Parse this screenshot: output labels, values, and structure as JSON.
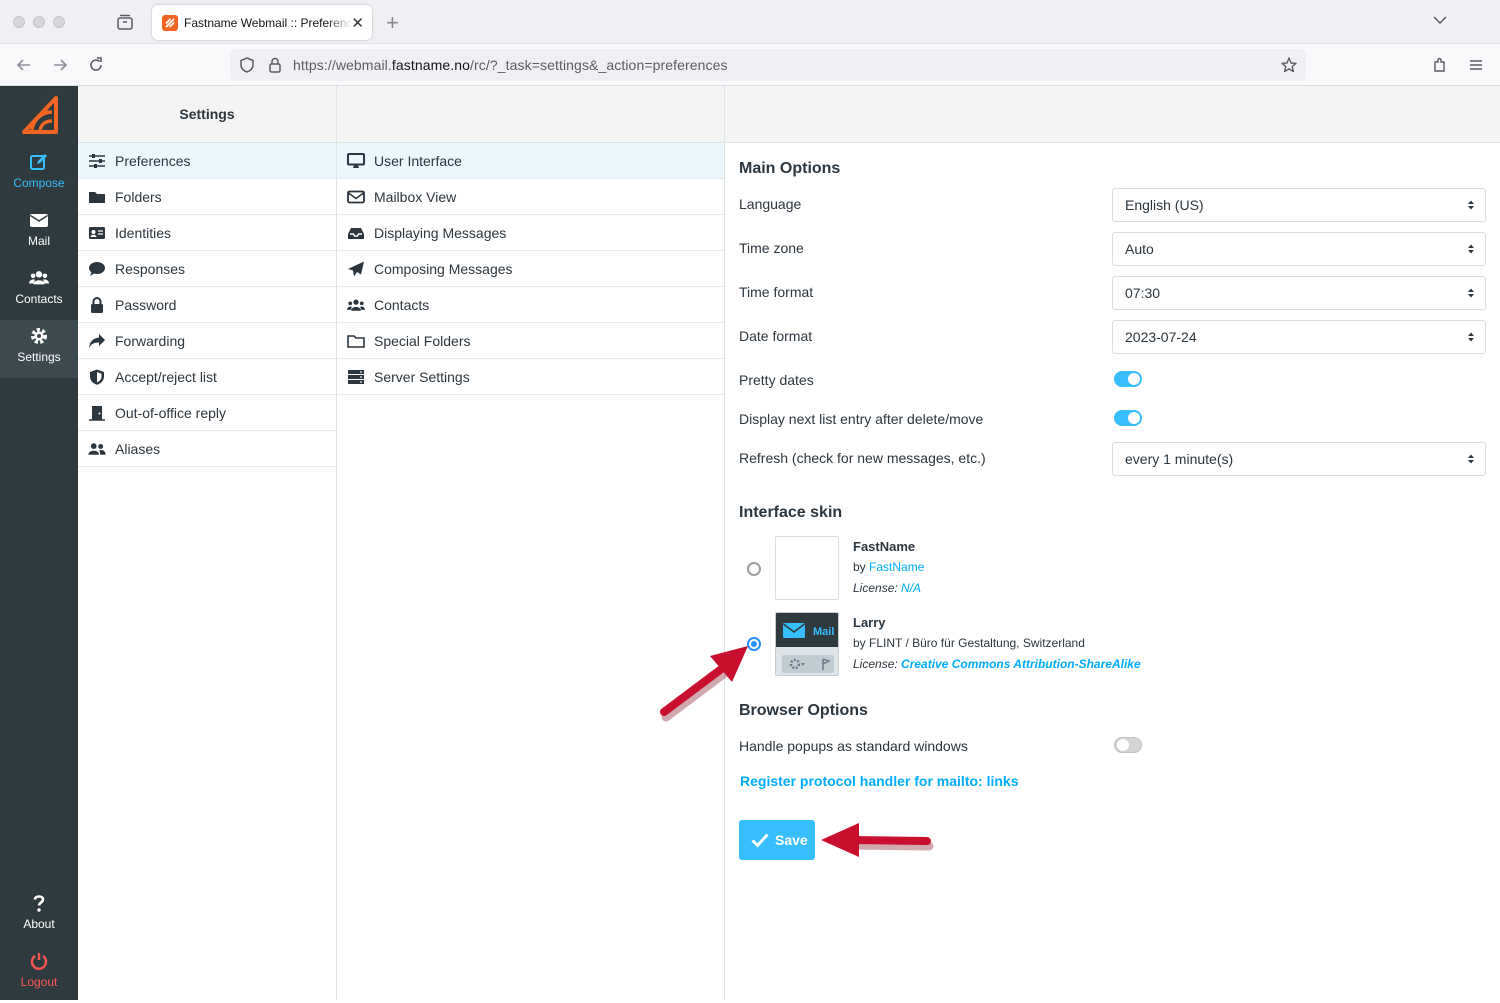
{
  "browser": {
    "tab_title": "Fastname Webmail :: Preferences",
    "url_prefix": "https://webmail.",
    "url_domain": "fastname.no",
    "url_suffix": "/rc/?_task=settings&_action=preferences"
  },
  "rail": {
    "compose": "Compose",
    "mail": "Mail",
    "contacts": "Contacts",
    "settings": "Settings",
    "about": "About",
    "logout": "Logout"
  },
  "settings": {
    "header": "Settings",
    "items": [
      {
        "label": "Preferences",
        "icon": "sliders-icon"
      },
      {
        "label": "Folders",
        "icon": "folder-icon"
      },
      {
        "label": "Identities",
        "icon": "id-card-icon"
      },
      {
        "label": "Responses",
        "icon": "comment-icon"
      },
      {
        "label": "Password",
        "icon": "lock-icon"
      },
      {
        "label": "Forwarding",
        "icon": "share-icon"
      },
      {
        "label": "Accept/reject list",
        "icon": "shield-icon"
      },
      {
        "label": "Out-of-office reply",
        "icon": "door-icon"
      },
      {
        "label": "Aliases",
        "icon": "users-icon"
      }
    ]
  },
  "sections": {
    "items": [
      {
        "label": "User Interface",
        "icon": "desktop-icon"
      },
      {
        "label": "Mailbox View",
        "icon": "envelope-icon"
      },
      {
        "label": "Displaying Messages",
        "icon": "inbox-icon"
      },
      {
        "label": "Composing Messages",
        "icon": "paper-plane-icon"
      },
      {
        "label": "Contacts",
        "icon": "users-icon"
      },
      {
        "label": "Special Folders",
        "icon": "folder-open-icon"
      },
      {
        "label": "Server Settings",
        "icon": "server-icon"
      }
    ]
  },
  "main": {
    "main_options_title": "Main Options",
    "language_label": "Language",
    "language_value": "English (US)",
    "timezone_label": "Time zone",
    "timezone_value": "Auto",
    "timeformat_label": "Time format",
    "timeformat_value": "07:30",
    "dateformat_label": "Date format",
    "dateformat_value": "2023-07-24",
    "pretty_dates_label": "Pretty dates",
    "pretty_dates_on": true,
    "next_entry_label": "Display next list entry after delete/move",
    "next_entry_on": true,
    "refresh_label": "Refresh (check for new messages, etc.)",
    "refresh_value": "every 1 minute(s)",
    "skin_title": "Interface skin",
    "skins": [
      {
        "name": "FastName",
        "by": "by ",
        "author": "FastName",
        "license_label": "License: ",
        "license": "N/A",
        "selected": false
      },
      {
        "name": "Larry",
        "by": "by FLINT / Büro für Gestaltung, Switzerland",
        "license_label": "License: ",
        "license": "Creative Commons Attribution-ShareAlike",
        "selected": true,
        "thumb_text": "Mail"
      }
    ],
    "browser_options_title": "Browser Options",
    "popups_label": "Handle popups as standard windows",
    "popups_on": false,
    "register_link": "Register protocol handler for mailto: links",
    "save_label": "Save"
  },
  "colors": {
    "accent": "#37beff",
    "rail_bg": "#2f3a3f",
    "logout": "#ff5552",
    "annotation_arrow": "#c8102e"
  }
}
